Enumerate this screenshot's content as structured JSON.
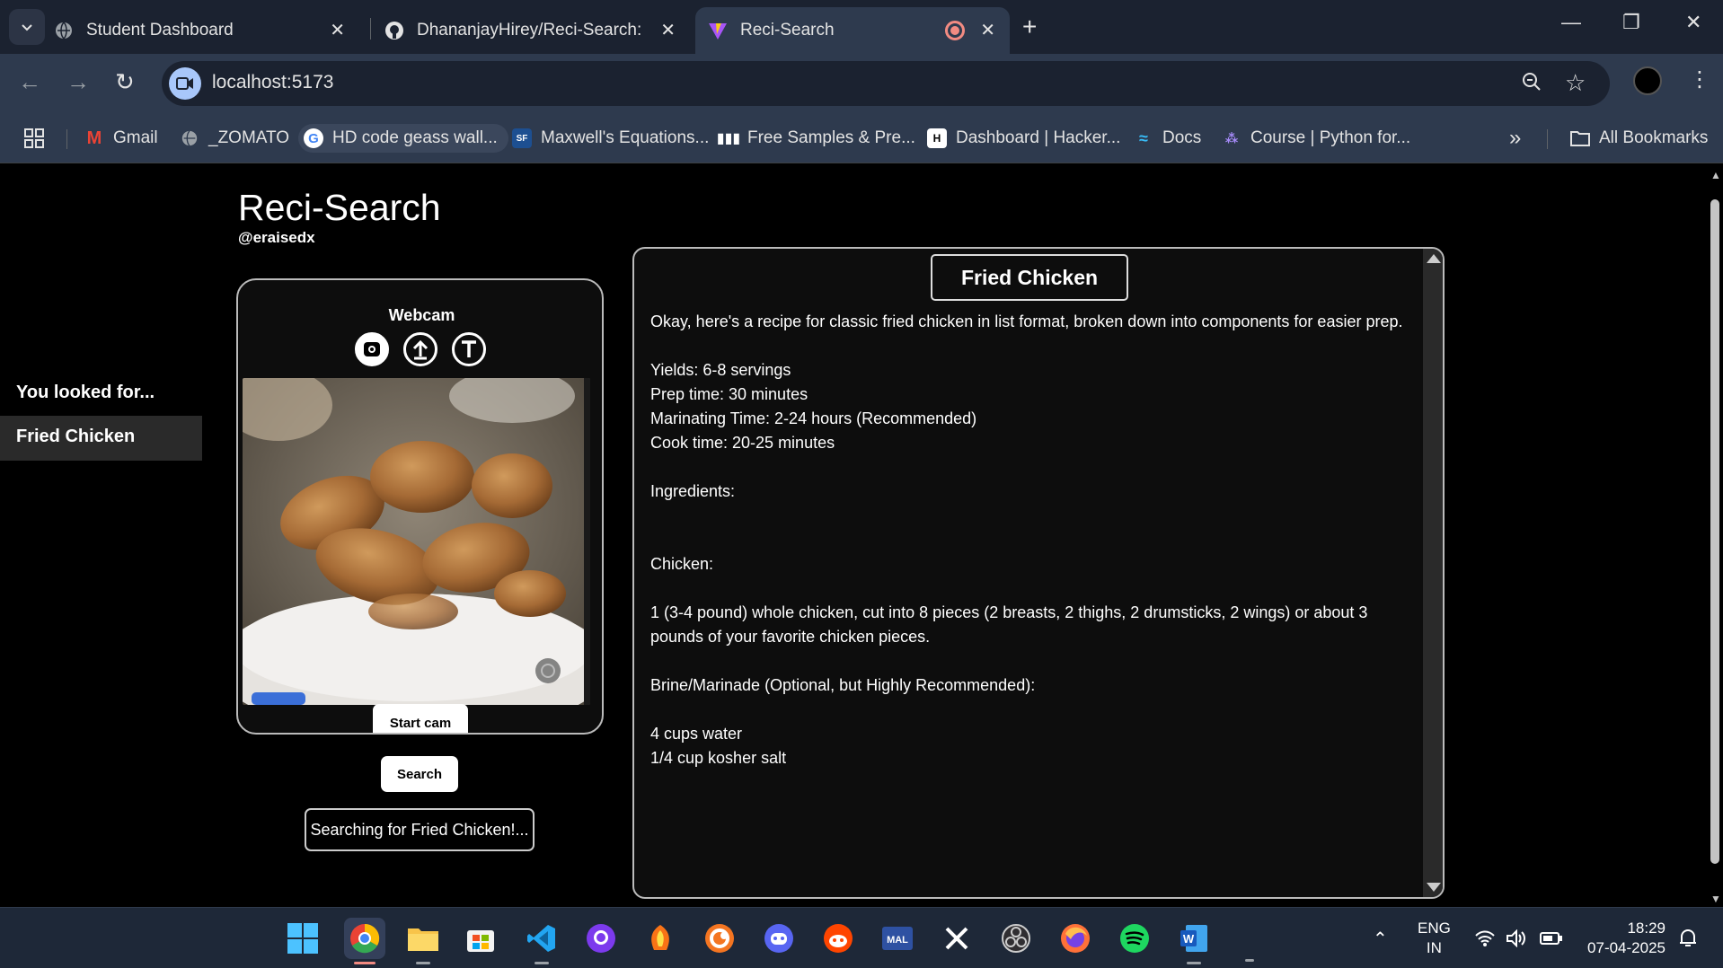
{
  "browser": {
    "tabs": [
      {
        "title": "Student Dashboard",
        "active": false
      },
      {
        "title": "DhananjayHirey/Reci-Search: A",
        "active": false
      },
      {
        "title": "Reci-Search",
        "active": true
      }
    ],
    "url": "localhost:5173",
    "bookmarks": [
      {
        "label": "Gmail"
      },
      {
        "label": "_ZOMATO"
      },
      {
        "label": "HD code geass wall..."
      },
      {
        "label": "Maxwell's Equations..."
      },
      {
        "label": "Free Samples & Pre..."
      },
      {
        "label": "Dashboard | Hacker..."
      },
      {
        "label": "Docs"
      },
      {
        "label": "Course | Python for..."
      }
    ],
    "all_bookmarks": "All Bookmarks",
    "overflow": "»"
  },
  "app": {
    "title": "Reci-Search",
    "handle": "@eraisedx"
  },
  "history": {
    "heading": "You looked for...",
    "items": [
      "Fried Chicken"
    ]
  },
  "webcam": {
    "title": "Webcam",
    "start_label": "Start cam"
  },
  "search": {
    "button_label": "Search",
    "status": "Searching for Fried Chicken!..."
  },
  "recipe": {
    "title": "Fried Chicken",
    "intro": "Okay, here's a recipe for classic fried chicken in list format, broken down into components for easier prep.",
    "yields": "Yields: 6-8 servings",
    "prep": "Prep time: 30 minutes",
    "marinate": "Marinating Time: 2-24 hours (Recommended)",
    "cook": "Cook time: 20-25 minutes",
    "ingredients_heading": "Ingredients:",
    "chicken_heading": "Chicken:",
    "chicken_item": "1 (3-4 pound) whole chicken, cut into 8 pieces (2 breasts, 2 thighs, 2 drumsticks, 2 wings) or about 3 pounds of your favorite chicken pieces.",
    "brine_heading": "Brine/Marinade (Optional, but Highly Recommended):",
    "brine_item1": "4 cups water",
    "brine_item2": "1/4 cup kosher salt"
  },
  "taskbar": {
    "lang_line1": "ENG",
    "lang_line2": "IN",
    "time": "18:29",
    "date": "07-04-2025"
  },
  "colors": {
    "page_bg": "#000000",
    "panel_border": "#bbbbbb",
    "chrome_bg": "#2e3a4e",
    "tab_bg": "#1b2230"
  }
}
